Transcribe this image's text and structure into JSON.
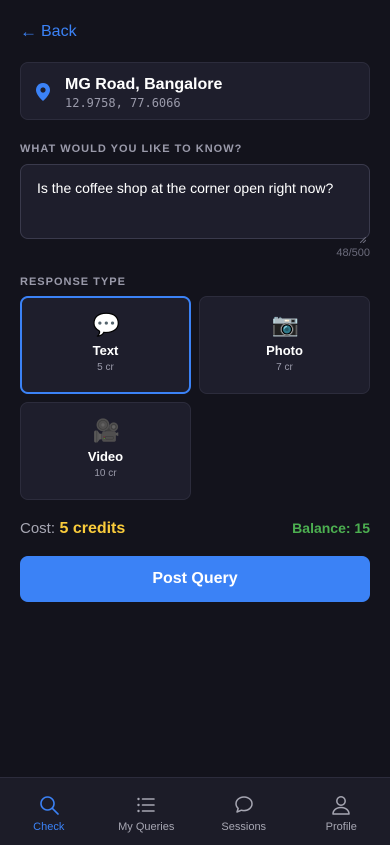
{
  "nav": {
    "back_label": "Back"
  },
  "location": {
    "name": "MG Road, Bangalore",
    "coords": "12.9758, 77.6066",
    "icon": "map-pin-icon"
  },
  "question": {
    "section_label": "WHAT WOULD YOU LIKE TO KNOW?",
    "value": "Is the coffee shop at the corner open right now?",
    "char_count": "48/500"
  },
  "response_type": {
    "section_label": "RESPONSE TYPE",
    "selected": "Text",
    "options": [
      {
        "icon": "💬",
        "label": "Text",
        "cost": "5 cr"
      },
      {
        "icon": "📷",
        "label": "Photo",
        "cost": "7 cr"
      },
      {
        "icon": "🎥",
        "label": "Video",
        "cost": "10 cr"
      }
    ]
  },
  "cost": {
    "label": "Cost:",
    "value": "5 credits",
    "balance": "Balance: 15"
  },
  "post_button": {
    "label": "Post Query"
  },
  "tabbar": {
    "active": "Check",
    "tabs": [
      {
        "label": "Check",
        "icon": "search-icon"
      },
      {
        "label": "My Queries",
        "icon": "list-icon"
      },
      {
        "label": "Sessions",
        "icon": "chat-bubbles-icon"
      },
      {
        "label": "Profile",
        "icon": "person-icon"
      }
    ]
  },
  "colors": {
    "accent": "#3b82f6",
    "background": "#13131c",
    "card": "#1e1e2c",
    "cost": "#facc3b",
    "balance": "#4caf50"
  }
}
